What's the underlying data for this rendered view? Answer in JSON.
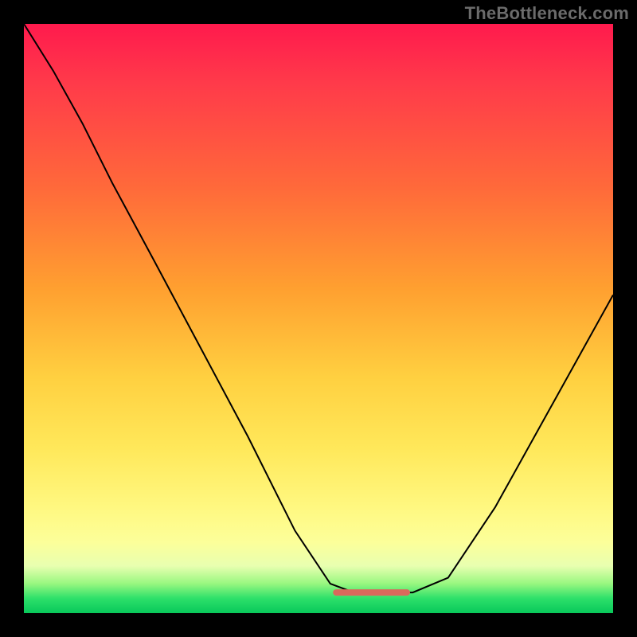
{
  "watermark": "TheBottleneck.com",
  "colors": {
    "page_bg": "#000000",
    "curve_stroke": "#000000",
    "flat_segment_stroke": "#d96a5c",
    "gradient_top": "#ff1a4d",
    "gradient_bottom": "#08c85a"
  },
  "chart_data": {
    "type": "line",
    "title": "",
    "xlabel": "",
    "ylabel": "",
    "xlim": [
      0,
      1
    ],
    "ylim": [
      0,
      1
    ],
    "note": "Axes are unlabeled; values are normalized 0–1 estimates read from pixel positions. y=1 is top (red), y=0 is bottom (green).",
    "series": [
      {
        "name": "main-curve",
        "x": [
          0.0,
          0.05,
          0.1,
          0.15,
          0.22,
          0.3,
          0.38,
          0.46,
          0.52,
          0.56,
          0.6,
          0.66,
          0.72,
          0.8,
          0.9,
          1.0
        ],
        "y": [
          1.0,
          0.92,
          0.83,
          0.73,
          0.6,
          0.45,
          0.3,
          0.14,
          0.05,
          0.035,
          0.035,
          0.035,
          0.06,
          0.18,
          0.36,
          0.54
        ]
      },
      {
        "name": "flat-bottom-segment",
        "x": [
          0.53,
          0.65
        ],
        "y": [
          0.035,
          0.035
        ]
      }
    ]
  }
}
